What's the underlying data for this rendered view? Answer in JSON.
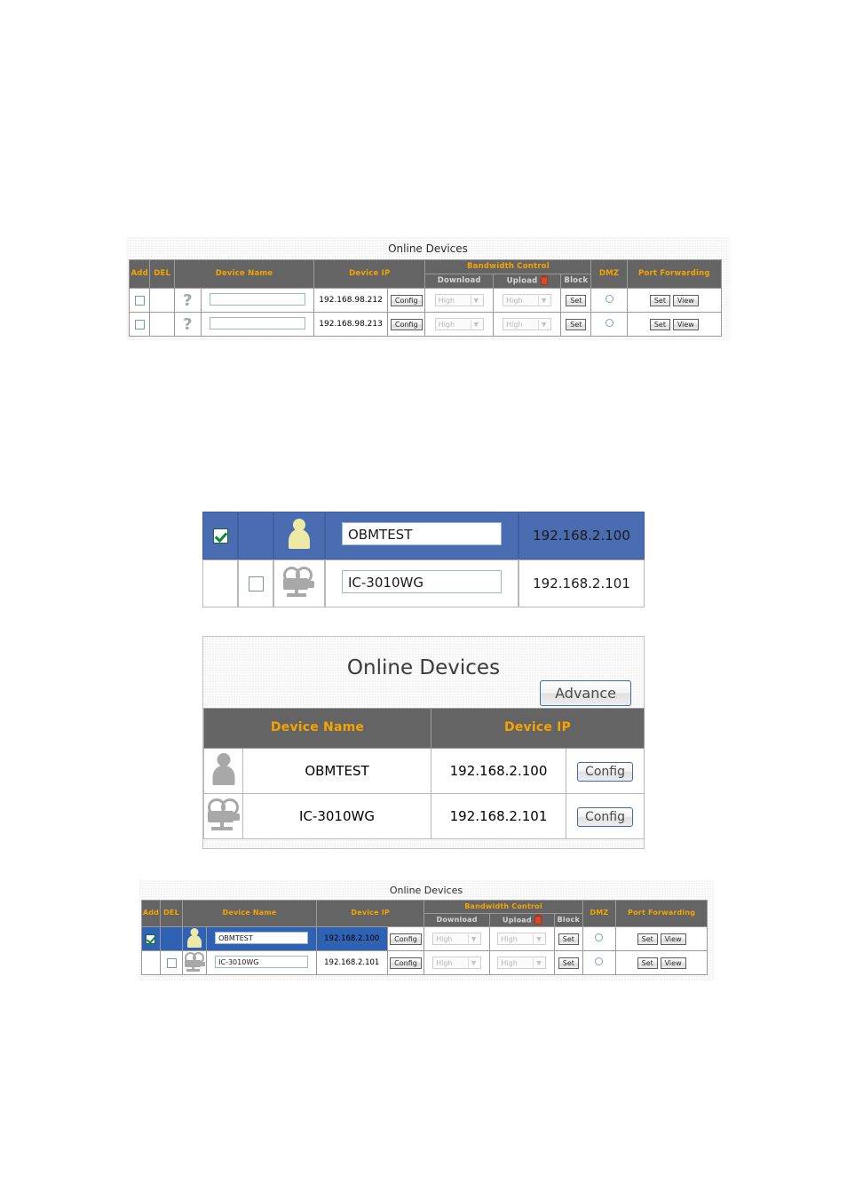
{
  "figure1": {
    "title": "Online Devices",
    "columns": {
      "add": "Add",
      "del": "DEL",
      "device_name": "Device Name",
      "device_ip": "Device IP",
      "bandwidth_control": "Bandwidth Control",
      "download": "Download",
      "upload": "Upload",
      "block": "Block",
      "dmz": "DMZ",
      "port_forwarding": "Port Forwarding"
    },
    "icons": {
      "upload_lock": "lock-icon",
      "device_unknown": "question-mark-icon"
    },
    "buttons": {
      "config": "Config",
      "set": "Set",
      "view": "View"
    },
    "bandwidth_value": "High",
    "rows": [
      {
        "add_checked": false,
        "del_checked": false,
        "device_icon": "question-mark-icon",
        "device_name": "",
        "device_name_placeholder": "",
        "device_ip": "192.168.98.212",
        "download": "High",
        "upload": "High",
        "dmz_selected": false
      },
      {
        "add_checked": false,
        "del_checked": false,
        "device_icon": "question-mark-icon",
        "device_name": "",
        "device_name_placeholder": "",
        "device_ip": "192.168.98.213",
        "download": "High",
        "upload": "High",
        "dmz_selected": false
      }
    ]
  },
  "figure2": {
    "rows": [
      {
        "selected": true,
        "add_checked": true,
        "del_checked": false,
        "device_icon": "person-icon",
        "device_name": "OBMTEST",
        "device_ip": "192.168.2.100"
      },
      {
        "selected": false,
        "add_checked": false,
        "del_checked": false,
        "device_icon": "video-camera-icon",
        "device_name": "IC-3010WG",
        "device_ip": "192.168.2.101"
      }
    ]
  },
  "figure3": {
    "title": "Online Devices",
    "advance_label": "Advance",
    "columns": {
      "device_name": "Device Name",
      "device_ip": "Device IP"
    },
    "config_label": "Config",
    "rows": [
      {
        "device_icon": "person-icon",
        "device_name": "OBMTEST",
        "device_ip": "192.168.2.100",
        "config": "Config"
      },
      {
        "device_icon": "video-camera-icon",
        "device_name": "IC-3010WG",
        "device_ip": "192.168.2.101",
        "config": "Config"
      }
    ]
  },
  "figure4": {
    "title": "Online Devices",
    "columns": {
      "add": "Add",
      "del": "DEL",
      "device_name": "Device Name",
      "device_ip": "Device IP",
      "bandwidth_control": "Bandwidth Control",
      "download": "Download",
      "upload": "Upload",
      "block": "Block",
      "dmz": "DMZ",
      "port_forwarding": "Port Forwarding"
    },
    "buttons": {
      "config": "Config",
      "set": "Set",
      "view": "View"
    },
    "rows": [
      {
        "selected": true,
        "add_checked": true,
        "del_checked": false,
        "device_icon": "person-icon",
        "device_name": "OBMTEST",
        "device_ip": "192.168.2.100",
        "download": "High",
        "upload": "High",
        "dmz_selected": false
      },
      {
        "selected": false,
        "add_checked": false,
        "del_checked": false,
        "device_icon": "video-camera-icon",
        "device_name": "IC-3010WG",
        "device_ip": "192.168.2.101",
        "download": "High",
        "upload": "High",
        "dmz_selected": false
      }
    ]
  },
  "colors": {
    "header_bg": "#646464",
    "header_text": "#f5a400",
    "selected_row_blue": "#4a6cb0",
    "selected_row_blue_alt": "#2f62b3",
    "person_icon_yellow": "#efe9a6",
    "camera_icon_gray": "#a8a8a8",
    "panel_border": "#c2c2c2",
    "button_blue_border": "#3c6ea5",
    "upload_lock_red": "#d94a2b"
  }
}
